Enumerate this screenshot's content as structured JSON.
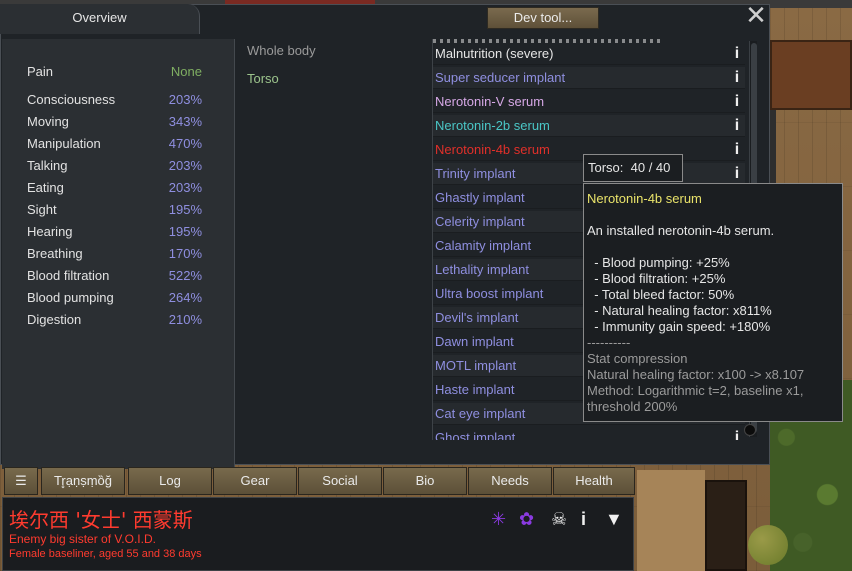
{
  "window": {
    "overview_tab": "Overview",
    "dev_tool": "Dev tool...",
    "close": "✕"
  },
  "capacities": [
    {
      "name": "Pain",
      "value": "None"
    },
    {
      "name": "Consciousness",
      "value": "203%"
    },
    {
      "name": "Moving",
      "value": "343%"
    },
    {
      "name": "Manipulation",
      "value": "470%"
    },
    {
      "name": "Talking",
      "value": "203%"
    },
    {
      "name": "Eating",
      "value": "203%"
    },
    {
      "name": "Sight",
      "value": "195%"
    },
    {
      "name": "Hearing",
      "value": "195%"
    },
    {
      "name": "Breathing",
      "value": "170%"
    },
    {
      "name": "Blood filtration",
      "value": "522%"
    },
    {
      "name": "Blood pumping",
      "value": "264%"
    },
    {
      "name": "Digestion",
      "value": "210%"
    }
  ],
  "body_parts": {
    "whole": "Whole body",
    "torso": "Torso"
  },
  "hediffs": [
    {
      "label": "Malnutrition (severe)",
      "color": "#e6e6e6"
    },
    {
      "label": "Super seducer implant",
      "color": "#8f8fe0"
    },
    {
      "label": "Nerotonin-V serum",
      "color": "#d6a8e6"
    },
    {
      "label": "Nerotonin-2b serum",
      "color": "#4ac6c6"
    },
    {
      "label": "Nerotonin-4b serum",
      "color": "#e0302a"
    },
    {
      "label": "Trinity implant",
      "color": "#8f8fe0"
    },
    {
      "label": "Ghastly implant",
      "color": "#8f8fe0"
    },
    {
      "label": "Celerity implant",
      "color": "#8f8fe0"
    },
    {
      "label": "Calamity implant",
      "color": "#8f8fe0"
    },
    {
      "label": "Lethality implant",
      "color": "#8f8fe0"
    },
    {
      "label": "Ultra boost implant",
      "color": "#8f8fe0"
    },
    {
      "label": "Devil's implant",
      "color": "#8f8fe0"
    },
    {
      "label": "Dawn implant",
      "color": "#8f8fe0"
    },
    {
      "label": "MOTL implant",
      "color": "#8f8fe0"
    },
    {
      "label": "Haste implant",
      "color": "#8f8fe0"
    },
    {
      "label": "Cat eye implant",
      "color": "#8f8fe0"
    },
    {
      "label": "Ghost implant",
      "color": "#8f8fe0"
    }
  ],
  "info_glyph": "i",
  "tooltip_part": "Torso:  40 / 40",
  "tooltip": {
    "title": "Nerotonin-4b serum",
    "desc": "An installed nerotonin-4b serum.",
    "effects": [
      "  - Blood pumping: +25%",
      "  - Blood filtration: +25%",
      "  - Total bleed factor: 50%",
      "  - Natural healing factor: x811%",
      "  - Immunity gain speed: +180%"
    ],
    "separator": "----------",
    "stat_lines": [
      "Stat compression",
      "Natural healing factor: x100 -> x8.107",
      "Method: Logarithmic t=2, baseline x1,",
      "threshold 200%"
    ]
  },
  "tabs": {
    "menu": "☰",
    "items": [
      "Tr̥ạṇṣṃȍğ",
      "Log",
      "Gear",
      "Social",
      "Bio",
      "Needs",
      "Health"
    ]
  },
  "character": {
    "name": "埃尔西 '女士' 西蒙斯",
    "title": "Enemy big sister of V.O.I.D.",
    "desc": "Female baseliner, aged 55 and 38 days",
    "icons": [
      "spider-icon",
      "octopus-icon",
      "skull-icon",
      "info-icon",
      "drop-icon"
    ]
  },
  "colors": {
    "accent_purple": "#8f8fe0",
    "torso_green": "#9cc48c",
    "tooltip_title": "#e9e36a",
    "enemy_red": "#ff3b2f"
  }
}
